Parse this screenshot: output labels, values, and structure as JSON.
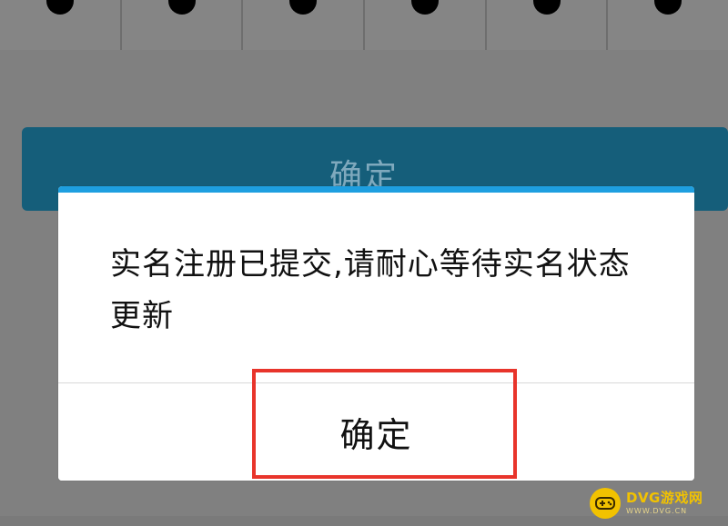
{
  "background": {
    "top_key_count": 6,
    "confirm_button_label": "确定",
    "confirm_button_color": "#155e7a"
  },
  "dialog": {
    "accent_color": "#1e9fe0",
    "message": "实名注册已提交,请耐心等待实名状态更新",
    "confirm_label": "确定"
  },
  "highlight": {
    "color": "#e8342b"
  },
  "watermark": {
    "brand": "DVG游戏网",
    "domain": "WWW.DVG.CN",
    "icon": "gamepad-icon",
    "color": "#f2c200"
  }
}
